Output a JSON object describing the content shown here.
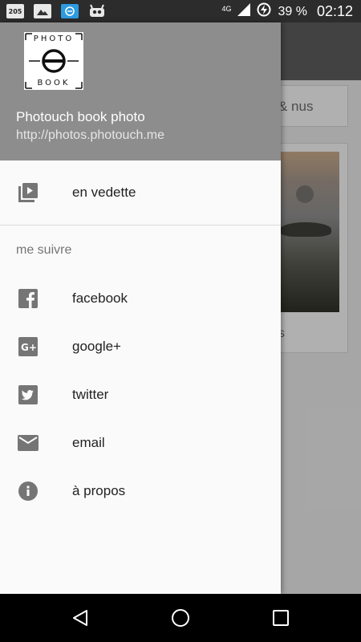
{
  "status_bar": {
    "notif_calendar": "205",
    "network": "4G",
    "battery": "39 %",
    "time": "02:12"
  },
  "background_app": {
    "card1_text": "& nus",
    "card2_text": "s"
  },
  "drawer": {
    "header": {
      "logo_top": "PHOTO",
      "logo_bottom": "BOOK",
      "title": "Photouch book photo",
      "url": "http://photos.photouch.me"
    },
    "items": [
      {
        "label": "en vedette",
        "icon": "video-library-icon"
      },
      {
        "label": "facebook",
        "icon": "facebook-icon"
      },
      {
        "label": "google+",
        "icon": "google-plus-icon"
      },
      {
        "label": "twitter",
        "icon": "twitter-icon"
      },
      {
        "label": "email",
        "icon": "email-icon"
      },
      {
        "label": "à propos",
        "icon": "info-icon"
      }
    ],
    "section_label": "me suivre"
  },
  "navigation_bar": {
    "back": "back-icon",
    "home": "home-icon",
    "recents": "recents-icon"
  },
  "colors": {
    "header_bg": "#8d8d8d",
    "drawer_bg": "#fafafa",
    "icon_gray": "#757575"
  }
}
